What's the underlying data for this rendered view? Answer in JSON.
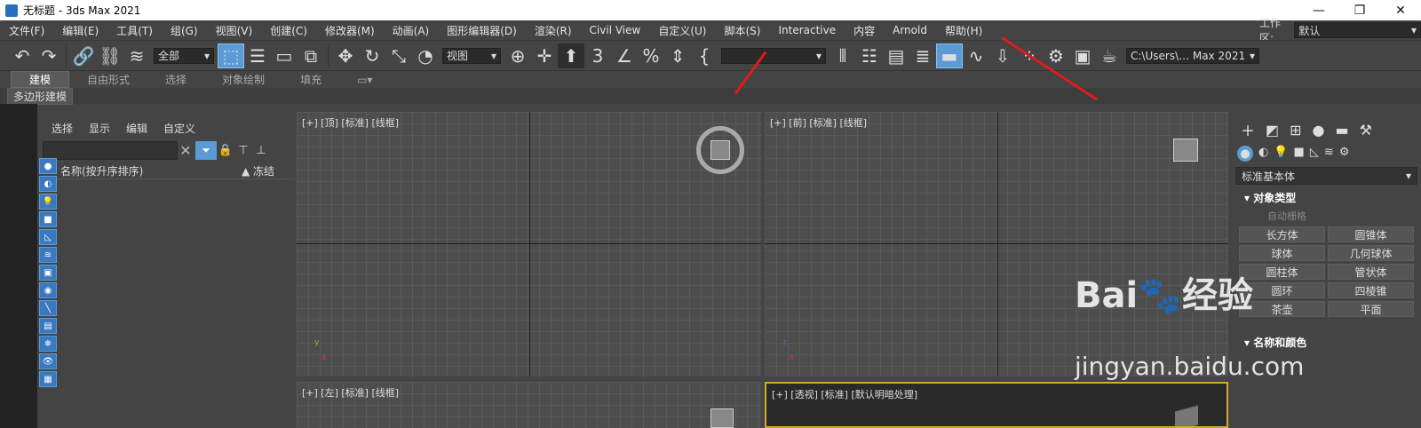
{
  "window": {
    "title": "无标题 - 3ds Max 2021",
    "minimize": "—",
    "maximize": "❐",
    "close": "✕"
  },
  "menu": [
    "文件(F)",
    "编辑(E)",
    "工具(T)",
    "组(G)",
    "视图(V)",
    "创建(C)",
    "修改器(M)",
    "动画(A)",
    "图形编辑器(D)",
    "渲染(R)",
    "Civil View",
    "自定义(U)",
    "脚本(S)",
    "Interactive",
    "内容",
    "Arnold",
    "帮助(H)"
  ],
  "workspace": {
    "label": "工作区:",
    "value": "默认"
  },
  "toolbar": {
    "selection_filter": "全部",
    "reference_coord": "视图",
    "named_selection": "",
    "project_path": "C:\\Users\\… Max 2021"
  },
  "ribbon": {
    "tabs": [
      "建模",
      "自由形式",
      "选择",
      "对象绘制",
      "填充"
    ],
    "sub": "多边形建模"
  },
  "scene_explorer": {
    "tabs": [
      "选择",
      "显示",
      "编辑",
      "自定义"
    ],
    "search_placeholder": "",
    "col_name": "名称(按升序排序)",
    "col_frozen": "▲ 冻结"
  },
  "viewports": [
    {
      "label": "[+] [顶] [标准] [线框]"
    },
    {
      "label": "[+] [前] [标准] [线框]"
    },
    {
      "label": "[+] [左] [标准] [线框]"
    },
    {
      "label": "[+] [透视] [标准] [默认明暗处理]"
    }
  ],
  "command_panel": {
    "category": "标准基本体",
    "rollout_object_type": "对象类型",
    "autogrid": "自动栅格",
    "buttons": [
      "长方体",
      "圆锥体",
      "球体",
      "几何球体",
      "圆柱体",
      "管状体",
      "圆环",
      "四棱锥",
      "茶壶",
      "平面"
    ],
    "rollout_name_color": "名称和颜色",
    "object_color": "#d43587"
  },
  "watermark": {
    "brand": "Bai🐾经验",
    "url": "jingyan.baidu.com"
  },
  "colors": {
    "accent": "#5b9bd5",
    "arrow": "#e01b1b",
    "persp_border": "#d6a82e"
  }
}
